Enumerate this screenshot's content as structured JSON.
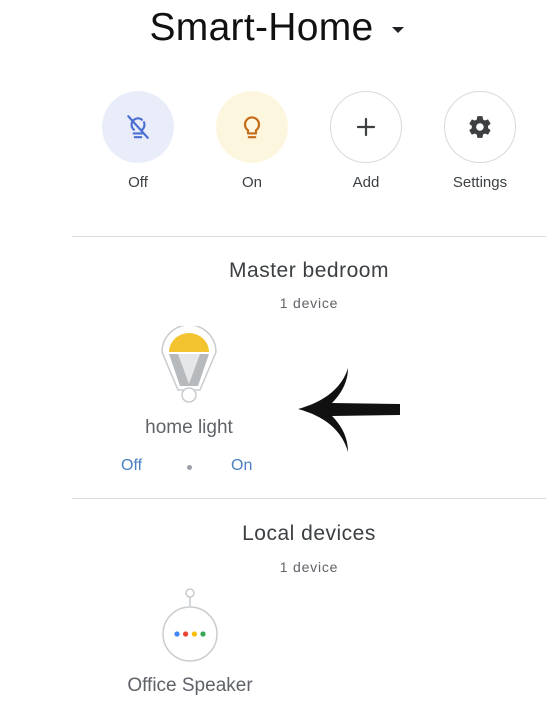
{
  "header": {
    "home_name": "Smart-Home"
  },
  "quick_actions": [
    {
      "label": "Off",
      "icon": "lightbulb-off-icon"
    },
    {
      "label": "On",
      "icon": "lightbulb-icon"
    },
    {
      "label": "Add",
      "icon": "plus-icon"
    },
    {
      "label": "Settings",
      "icon": "gear-icon"
    }
  ],
  "rooms": [
    {
      "name": "Master bedroom",
      "device_count": "1 device",
      "devices": [
        {
          "name": "home light",
          "icon": "light-bulb-device-icon",
          "off_label": "Off",
          "on_label": "On"
        }
      ]
    },
    {
      "name": "Local devices",
      "device_count": "1 device",
      "devices": [
        {
          "name": "Office Speaker",
          "icon": "google-home-speaker-icon"
        }
      ]
    }
  ],
  "colors": {
    "accent_blue": "#4a7fc1",
    "bulb_yellow": "#f4c430",
    "off_circle": "#e8edf9",
    "on_circle": "#fdf6df",
    "on_icon": "#c26a15",
    "off_icon": "#4a6fd1"
  }
}
